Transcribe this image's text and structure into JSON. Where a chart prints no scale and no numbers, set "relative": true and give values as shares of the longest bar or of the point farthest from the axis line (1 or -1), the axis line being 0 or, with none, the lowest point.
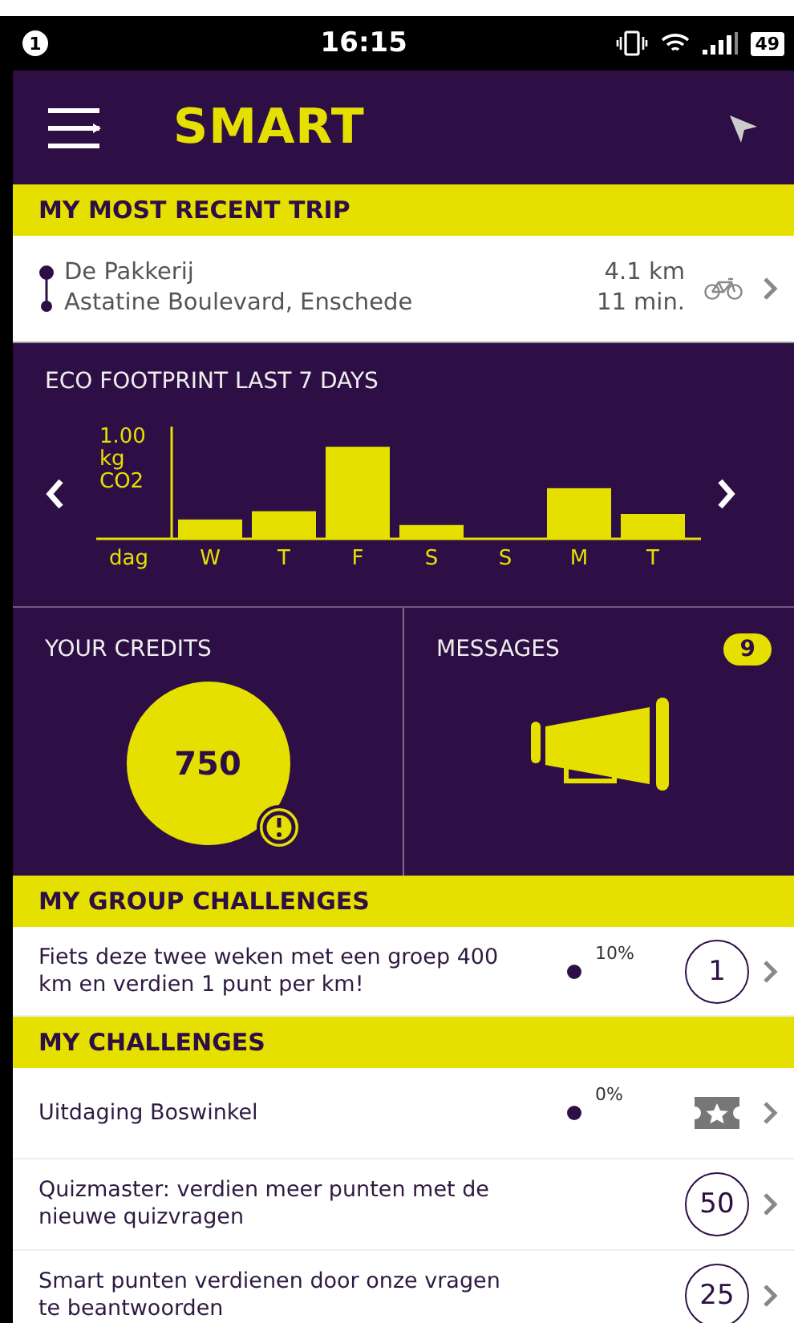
{
  "status_bar": {
    "notification_count": "1",
    "time": "16:15",
    "battery": "49"
  },
  "header": {
    "logo": "SMART"
  },
  "recent_trip": {
    "title": "MY MOST RECENT TRIP",
    "from": "De Pakkerij",
    "to": "Astatine Boulevard, Enschede",
    "distance": "4.1 km",
    "duration": "11 min."
  },
  "eco_footprint": {
    "title": "ECO FOOTPRINT LAST 7 DAYS",
    "chart_data": {
      "type": "bar",
      "xlabel": "dag",
      "categories": [
        "W",
        "T",
        "F",
        "S",
        "S",
        "M",
        "T"
      ],
      "values": [
        0.21,
        0.3,
        1,
        0.15,
        0,
        0.55,
        0.27
      ],
      "relative": true,
      "annotations": [
        "1.00 kg CO2"
      ]
    }
  },
  "credits": {
    "title": "YOUR CREDITS",
    "value": "750"
  },
  "messages": {
    "title": "MESSAGES",
    "count": "9"
  },
  "group_challenges": {
    "title": "MY GROUP CHALLENGES",
    "items": [
      {
        "text": "Fiets deze twee weken met een groep 400 km en verdien 1 punt per km!",
        "progress": "10%",
        "reward": {
          "kind": "points",
          "value": "1"
        }
      }
    ]
  },
  "challenges": {
    "title": "MY CHALLENGES",
    "items": [
      {
        "text": "Uitdaging Boswinkel",
        "progress": "0%",
        "reward": {
          "kind": "star"
        }
      },
      {
        "text": "Quizmaster: verdien meer punten met de nieuwe quizvragen",
        "reward": {
          "kind": "points",
          "value": "50"
        }
      },
      {
        "text": "Smart punten verdienen door onze vragen te beantwoorden",
        "reward": {
          "kind": "points",
          "value": "25"
        }
      }
    ]
  }
}
